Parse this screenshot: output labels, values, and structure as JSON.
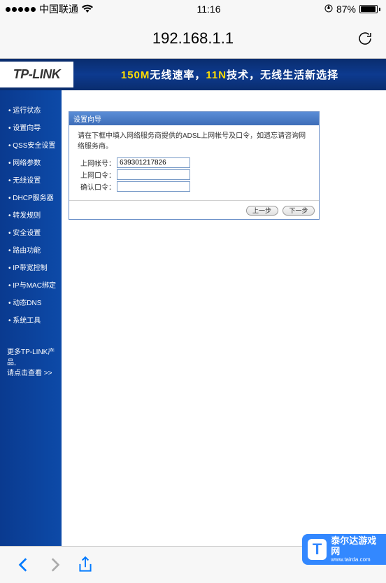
{
  "status": {
    "carrier": "中国联通",
    "time": "11:16",
    "battery_pct": "87%",
    "battery_fill_width": "87%"
  },
  "browser": {
    "url": "192.168.1.1"
  },
  "header": {
    "logo": "TP-LINK",
    "banner_part1": "150M",
    "banner_part2": "无线速率，",
    "banner_part3": "11N",
    "banner_part4": "技术，无线生活新选择"
  },
  "sidebar": {
    "items": [
      "运行状态",
      "设置向导",
      "QSS安全设置",
      "网络参数",
      "无线设置",
      "DHCP服务器",
      "转发规则",
      "安全设置",
      "路由功能",
      "IP带宽控制",
      "IP与MAC绑定",
      "动态DNS",
      "系统工具"
    ],
    "footer": {
      "line1": "更多TP-LINK产品,",
      "line2": "请点击查看 >>"
    }
  },
  "wizard": {
    "title": "设置向导",
    "desc": "请在下框中填入网络服务商提供的ADSL上网帐号及口令，如遗忘请咨询网络服务商。",
    "rows": [
      {
        "label": "上网帐号：",
        "value": "639301217826"
      },
      {
        "label": "上网口令：",
        "value": ""
      },
      {
        "label": "确认口令：",
        "value": ""
      }
    ],
    "buttons": {
      "prev": "上一步",
      "next": "下一步"
    }
  },
  "watermark": {
    "icon": "T",
    "name": "泰尔达游戏网",
    "url": "www.tairda.com"
  }
}
